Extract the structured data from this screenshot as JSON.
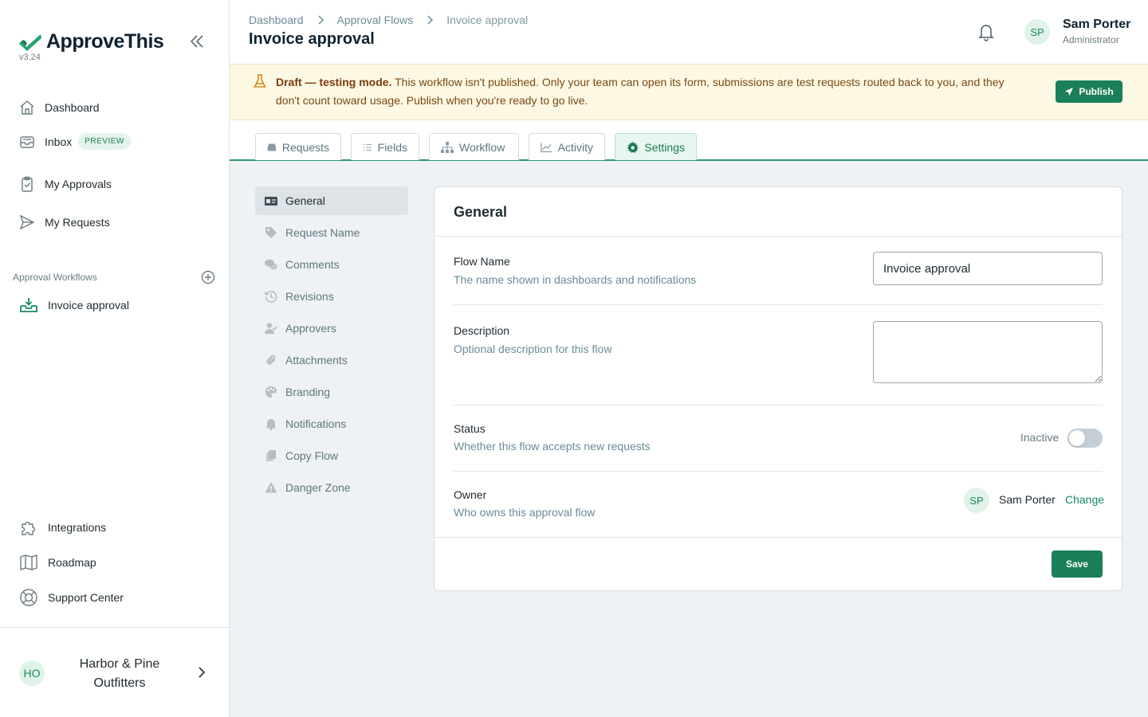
{
  "app": {
    "name": "ApproveThis",
    "version": "v3.24"
  },
  "sidebar": {
    "items": [
      {
        "label": "Dashboard",
        "icon": "home-icon"
      },
      {
        "label": "Inbox",
        "icon": "inbox-icon",
        "badge": "PREVIEW"
      },
      {
        "label": "My Approvals",
        "icon": "clipboard-check-icon"
      },
      {
        "label": "My Requests",
        "icon": "send-icon"
      }
    ],
    "section_label": "Approval Workflows",
    "flows": [
      {
        "label": "Invoice approval",
        "icon": "tray-download-icon"
      }
    ],
    "bottom_items": [
      {
        "label": "Integrations",
        "icon": "puzzle-icon"
      },
      {
        "label": "Roadmap",
        "icon": "map-icon"
      },
      {
        "label": "Support Center",
        "icon": "lifebuoy-icon"
      }
    ],
    "org": {
      "initials": "HO",
      "name": "Harbor & Pine Outfitters"
    }
  },
  "header": {
    "breadcrumb": [
      "Dashboard",
      "Approval Flows",
      "Invoice approval"
    ],
    "title": "Invoice approval",
    "user": {
      "initials": "SP",
      "name": "Sam Porter",
      "role": "Administrator"
    }
  },
  "banner": {
    "strong": "Draft — testing mode.",
    "text": " This workflow isn't published. Only your team can open its form, submissions are test requests routed back to you, and they don't count toward usage. Publish when you're ready to go live.",
    "action": "Publish"
  },
  "tabs": [
    {
      "label": "Requests",
      "icon": "inbox-icon"
    },
    {
      "label": "Fields",
      "icon": "list-icon"
    },
    {
      "label": "Workflow",
      "icon": "sitemap-icon"
    },
    {
      "label": "Activity",
      "icon": "chart-line-icon"
    },
    {
      "label": "Settings",
      "icon": "gear-icon",
      "active": true
    }
  ],
  "settings_nav": [
    {
      "label": "General",
      "icon": "id-card-icon",
      "active": true
    },
    {
      "label": "Request Name",
      "icon": "tag-icon"
    },
    {
      "label": "Comments",
      "icon": "comments-icon"
    },
    {
      "label": "Revisions",
      "icon": "history-icon"
    },
    {
      "label": "Approvers",
      "icon": "user-check-icon"
    },
    {
      "label": "Attachments",
      "icon": "paperclip-icon"
    },
    {
      "label": "Branding",
      "icon": "palette-icon"
    },
    {
      "label": "Notifications",
      "icon": "bell-icon"
    },
    {
      "label": "Copy Flow",
      "icon": "copy-icon"
    },
    {
      "label": "Danger Zone",
      "icon": "warning-icon"
    }
  ],
  "general": {
    "title": "General",
    "flow_name": {
      "label": "Flow Name",
      "help": "The name shown in dashboards and notifications",
      "value": "Invoice approval"
    },
    "description": {
      "label": "Description",
      "help": "Optional description for this flow",
      "value": ""
    },
    "status": {
      "label": "Status",
      "help": "Whether this flow accepts new requests",
      "value": "Inactive",
      "enabled": false
    },
    "owner": {
      "label": "Owner",
      "help": "Who owns this approval flow",
      "initials": "SP",
      "name": "Sam Porter",
      "action": "Change"
    },
    "save_label": "Save"
  },
  "colors": {
    "brand": "#1b7f59",
    "accent_light": "#e7f6ef",
    "banner_bg": "#fdf8e4",
    "banner_icon": "#d18a1a"
  }
}
